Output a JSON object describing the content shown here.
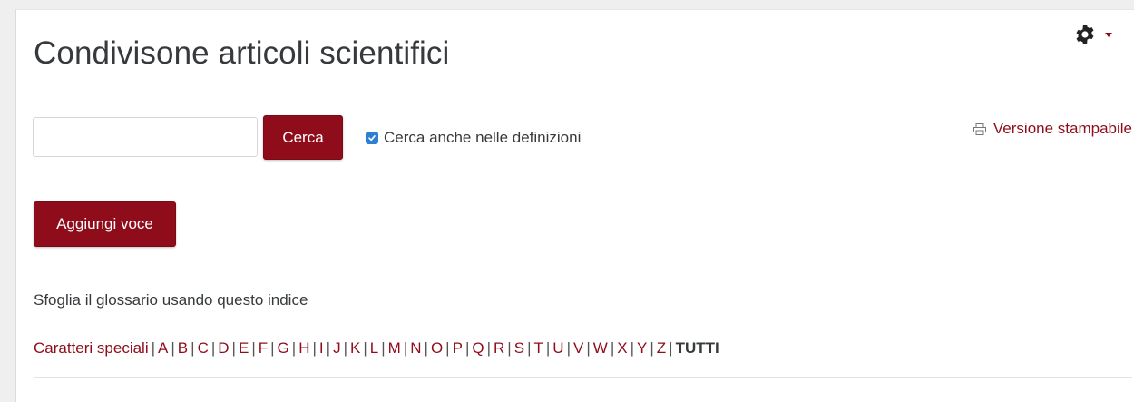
{
  "page": {
    "title": "Condivisone articoli scientifici"
  },
  "settings": {
    "icon": "gear-icon",
    "dropdown_icon": "caret-down-icon"
  },
  "print": {
    "label": "Versione stampabile",
    "icon": "printer-icon"
  },
  "search": {
    "value": "",
    "placeholder": "",
    "button_label": "Cerca",
    "checkbox_label": "Cerca anche nelle definizioni",
    "checkbox_checked": true
  },
  "actions": {
    "add_entry_label": "Aggiungi voce"
  },
  "browse": {
    "instruction": "Sfoglia il glossario usando questo indice",
    "special_label": "Caratteri speciali",
    "letters": [
      "A",
      "B",
      "C",
      "D",
      "E",
      "F",
      "G",
      "H",
      "I",
      "J",
      "K",
      "L",
      "M",
      "N",
      "O",
      "P",
      "Q",
      "R",
      "S",
      "T",
      "U",
      "V",
      "W",
      "X",
      "Y",
      "Z"
    ],
    "all_label": "TUTTI"
  },
  "colors": {
    "accent": "#8f0d1b",
    "checkbox": "#2d7fd3",
    "text": "#373a3c",
    "background": "#efefef"
  }
}
